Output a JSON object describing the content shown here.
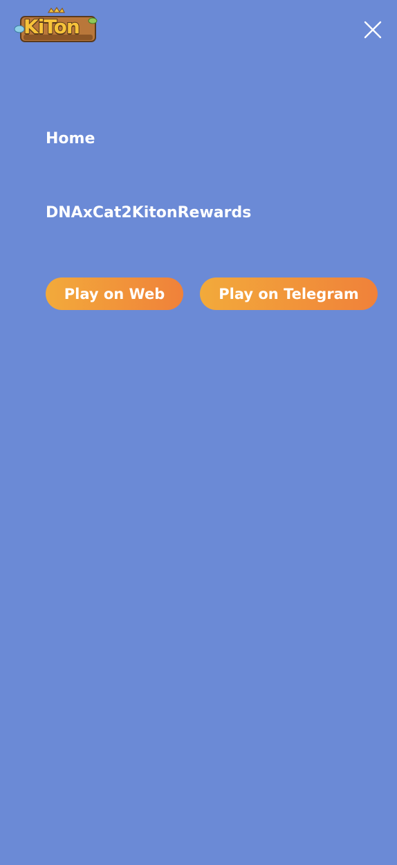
{
  "header": {
    "logo_text": "KiTon",
    "logo_icon": "kiton-logo-icon",
    "close_icon": "close-icon"
  },
  "nav": {
    "items": [
      {
        "label": "Home"
      },
      {
        "label": "DNAxCat2KitonRewards"
      }
    ]
  },
  "actions": {
    "play_web_label": "Play on Web",
    "play_telegram_label": "Play on Telegram"
  },
  "colors": {
    "background": "#6b8ad6",
    "button_gradient_start": "#f2aa3b",
    "button_gradient_end": "#f0813a",
    "text": "#ffffff"
  }
}
